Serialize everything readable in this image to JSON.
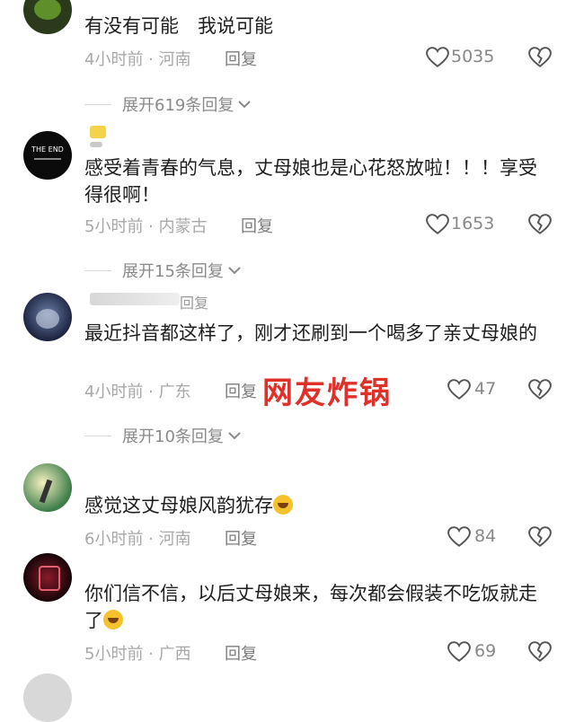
{
  "watermark": "网友炸锅",
  "comments": [
    {
      "text": "有没有可能　我说可能",
      "time_loc": "4小时前 · 河南",
      "reply": "回复",
      "likes": "5035",
      "expand": "展开619条回复"
    },
    {
      "avatar_text": "THE END",
      "text": "感受着青春的气息，丈母娘也是心花怒放啦！！！享受得很啊！",
      "time_loc": "5小时前 · 内蒙古",
      "reply": "回复",
      "likes": "1653",
      "expand": "展开15条回复"
    },
    {
      "name_fragment": "回复",
      "text": "最近抖音都这样了，刚才还刷到一个喝多了亲丈母娘的",
      "time_loc": "4小时前 · 广东",
      "reply": "回复",
      "likes": "47",
      "expand": "展开10条回复"
    },
    {
      "text": "感觉这丈母娘风韵犹存",
      "time_loc": "6小时前 · 河南",
      "reply": "回复",
      "likes": "84"
    },
    {
      "text": "你们信不信，以后丈母娘来，每次都会假装不吃饭就走了",
      "time_loc": "5小时前 · 广西",
      "reply": "回复",
      "likes": "69"
    }
  ],
  "icons": {
    "like": "heart-outline-icon",
    "dislike": "broken-heart-icon",
    "expand": "chevron-down-icon",
    "emoji": "laughing-tears-emoji"
  },
  "colors": {
    "watermark": "#e0302a",
    "meta": "#a8a8a8"
  }
}
